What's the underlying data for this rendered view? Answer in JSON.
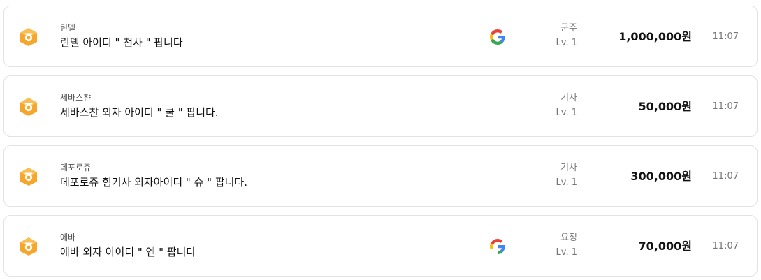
{
  "listings": [
    {
      "server": "린델",
      "title": "린델 아이디 \" 천사 \" 팝니다",
      "has_google": true,
      "rank": "군주",
      "level": "Lv. 1",
      "price": "1,000,000원",
      "time": "11:07"
    },
    {
      "server": "세바스챤",
      "title": "세바스챤 외자 아이디 \" 쿨 \" 팝니다.",
      "has_google": false,
      "rank": "기사",
      "level": "Lv. 1",
      "price": "50,000원",
      "time": "11:07"
    },
    {
      "server": "데포로쥬",
      "title": "데포로쥬 힘기사 외자아이디 \" 슈 \" 팝니다.",
      "has_google": false,
      "rank": "기사",
      "level": "Lv. 1",
      "price": "300,000원",
      "time": "11:07"
    },
    {
      "server": "에바",
      "title": "에바 외자 아이디 \" 엔 \" 팝니다",
      "has_google": true,
      "rank": "요정",
      "level": "Lv. 1",
      "price": "70,000원",
      "time": "11:07"
    }
  ],
  "icons": {
    "game": "lineage-game-icon",
    "account_type": "google-icon"
  },
  "colors": {
    "game_icon": "#f5a623",
    "border": "#e3e3e3"
  }
}
